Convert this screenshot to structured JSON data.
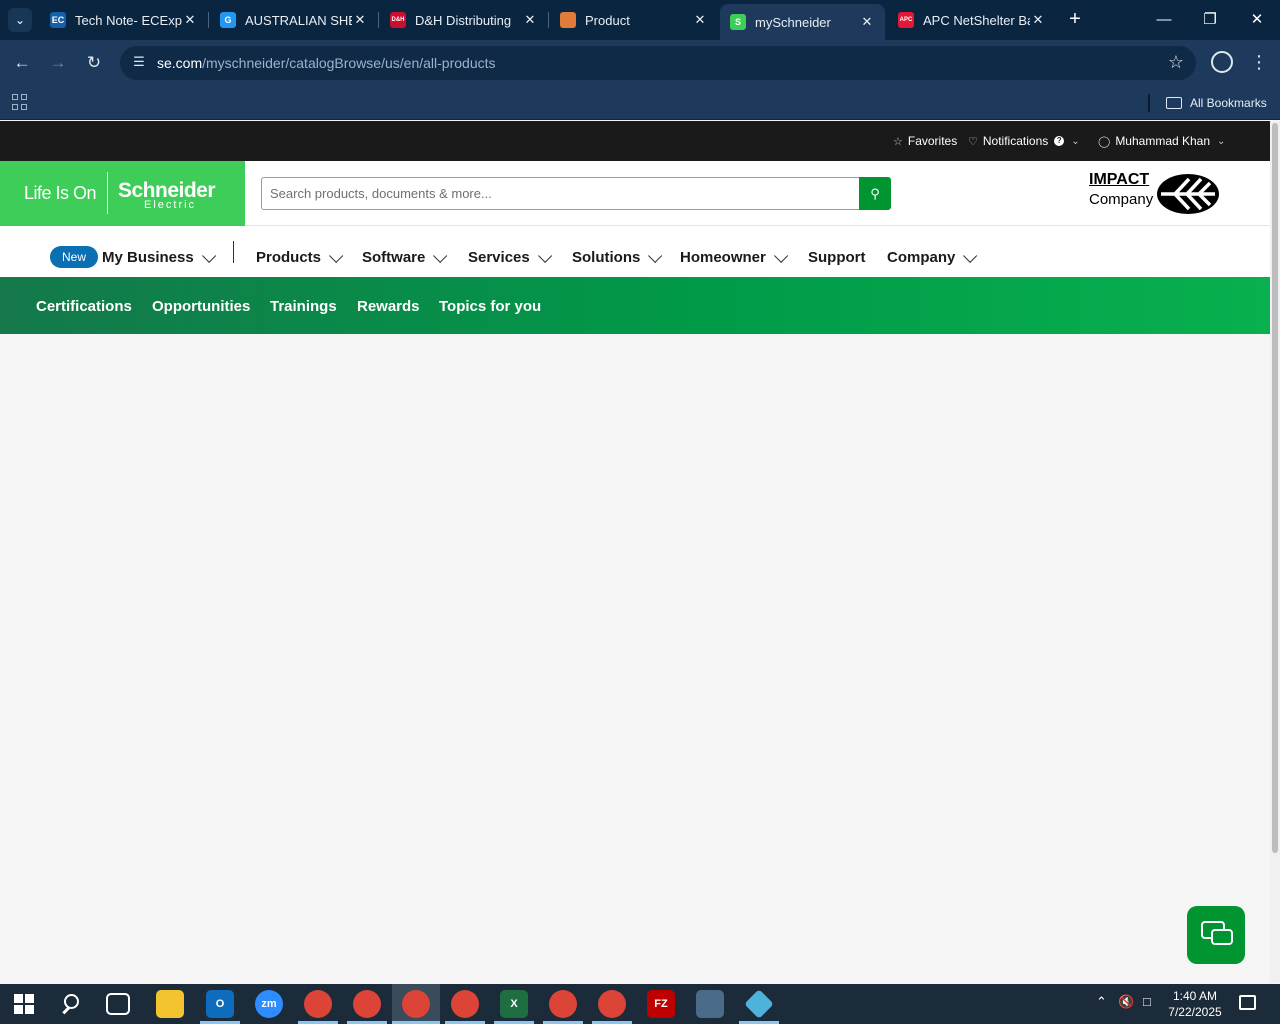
{
  "browser": {
    "tabs": [
      {
        "title": "Tech Note- ECExpr",
        "favicon": "EC",
        "favicon_color": "#1560a8"
      },
      {
        "title": "AUSTRALIAN SHEP",
        "favicon": "G",
        "favicon_color": "#2196f3"
      },
      {
        "title": "D&H Distributing",
        "favicon": "D&H",
        "favicon_color": "#c8102e"
      },
      {
        "title": "Product",
        "favicon": "box",
        "favicon_color": "#e07b3a"
      },
      {
        "title": "mySchneider",
        "favicon": "S",
        "favicon_color": "#3dcd58",
        "active": true
      },
      {
        "title": "APC NetShelter Ba",
        "favicon": "APC",
        "favicon_color": "#e21836"
      }
    ],
    "address": {
      "host": "se.com",
      "path": "/myschneider/catalogBrowse/us/en/all-products"
    },
    "bookmarks_bar": {
      "all_bookmarks_label": "All Bookmarks"
    }
  },
  "utility_bar": {
    "favorites": "Favorites",
    "notifications": "Notifications",
    "user": "Muhammad Khan"
  },
  "header": {
    "tagline": "Life Is On",
    "brand": "Schneider",
    "brand_sub": "Electric",
    "search_placeholder": "Search products, documents & more...",
    "impact_line1": "IMPACT",
    "impact_line2": "Company"
  },
  "main_nav": {
    "badge": "New",
    "items": [
      "My Business",
      "Products",
      "Software",
      "Services",
      "Solutions",
      "Homeowner",
      "Support",
      "Company"
    ]
  },
  "sub_nav": {
    "items": [
      "Certifications",
      "Opportunities",
      "Trainings",
      "Rewards",
      "Topics for you"
    ]
  },
  "taskbar": {
    "time": "1:40 AM",
    "date": "7/22/2025",
    "apps": [
      {
        "name": "file-explorer",
        "color": "#f4c430"
      },
      {
        "name": "outlook",
        "color": "#0f6cbd"
      },
      {
        "name": "zoom",
        "color": "#2d8cff"
      },
      {
        "name": "chrome-w",
        "color": "#db4437"
      },
      {
        "name": "chrome-2",
        "color": "#db4437"
      },
      {
        "name": "chrome-active",
        "color": "#db4437"
      },
      {
        "name": "chrome-4",
        "color": "#db4437"
      },
      {
        "name": "excel",
        "color": "#1d6f42"
      },
      {
        "name": "chrome-5",
        "color": "#db4437"
      },
      {
        "name": "chrome-6",
        "color": "#db4437"
      },
      {
        "name": "filezilla",
        "color": "#bf0000"
      },
      {
        "name": "calculator",
        "color": "#4a6a8a"
      },
      {
        "name": "app-diamond",
        "color": "#4fb3d9"
      }
    ]
  }
}
